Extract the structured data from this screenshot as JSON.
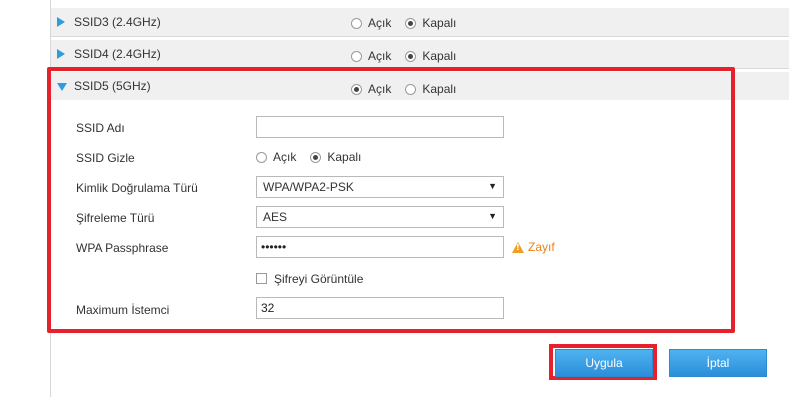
{
  "ssid_rows": [
    {
      "name": "SSID3 (2.4GHz)",
      "state": "Kapalı"
    },
    {
      "name": "SSID4 (2.4GHz)",
      "state": "Kapalı"
    },
    {
      "name": "SSID5 (5GHz)",
      "state": "Açık"
    }
  ],
  "radio_labels": {
    "on": "Açık",
    "off": "Kapalı"
  },
  "form": {
    "ssid_name_label": "SSID Adı",
    "ssid_name_value": "",
    "ssid_hide_label": "SSID Gizle",
    "ssid_hide_state": "Kapalı",
    "auth_label": "Kimlik Doğrulama Türü",
    "auth_value": "WPA/WPA2-PSK",
    "encryption_label": "Şifreleme Türü",
    "encryption_value": "AES",
    "passphrase_label": "WPA Passphrase",
    "passphrase_value": "••••••",
    "strength_text": "Zayıf",
    "show_password_label": "Şifreyi Görüntüle",
    "max_clients_label": "Maximum İstemci",
    "max_clients_value": "32"
  },
  "buttons": {
    "apply": "Uygula",
    "cancel": "İptal"
  },
  "colors": {
    "accent": "#2e9de0",
    "highlight": "#e5222b",
    "warning": "#e8821d"
  }
}
